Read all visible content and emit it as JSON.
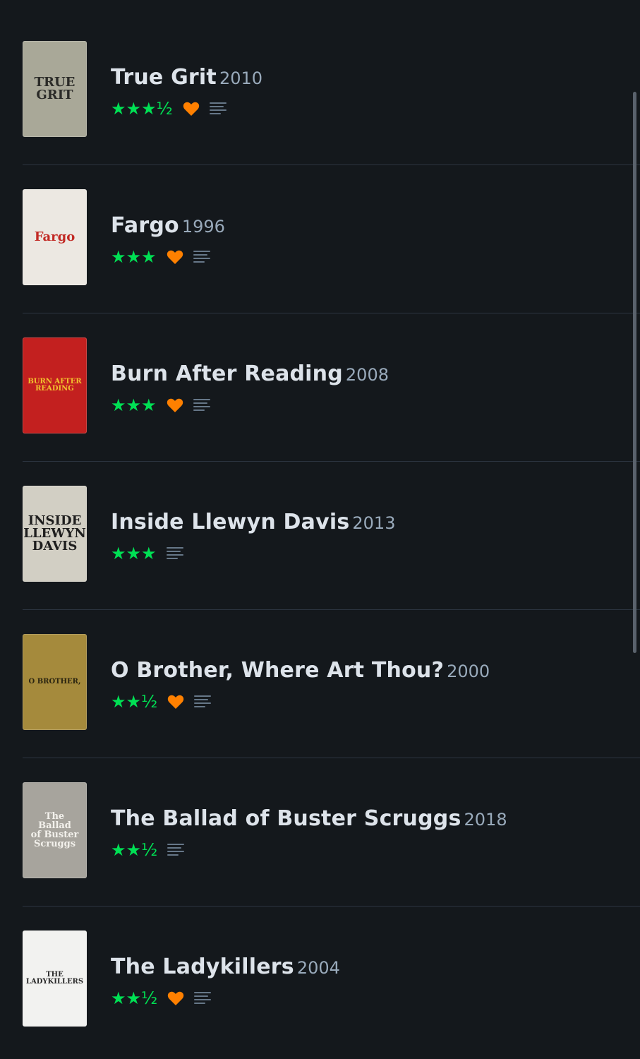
{
  "films": [
    {
      "title": "True Grit",
      "year": "2010",
      "stars": "★★★½",
      "rating": 3.5,
      "liked": true,
      "has_review": true,
      "poster": {
        "text": "TRUE\nGRIT",
        "bg": "#a9a898",
        "fg": "#2b2b28"
      }
    },
    {
      "title": "Fargo",
      "year": "1996",
      "stars": "★★★",
      "rating": 3,
      "liked": true,
      "has_review": true,
      "poster": {
        "text": "Fargo",
        "bg": "#ece8e2",
        "fg": "#c22a25"
      }
    },
    {
      "title": "Burn After Reading",
      "year": "2008",
      "stars": "★★★",
      "rating": 3,
      "liked": true,
      "has_review": true,
      "poster": {
        "text": "BURN AFTER\nREADING",
        "bg": "#c3201f",
        "fg": "#f2c12e"
      }
    },
    {
      "title": "Inside Llewyn Davis",
      "year": "2013",
      "stars": "★★★",
      "rating": 3,
      "liked": false,
      "has_review": true,
      "poster": {
        "text": "INSIDE\nLLEWYN\nDAVIS",
        "bg": "#d2cfc4",
        "fg": "#1e1e1e"
      }
    },
    {
      "title": "O Brother, Where Art Thou?",
      "year": "2000",
      "stars": "★★½",
      "rating": 2.5,
      "liked": true,
      "has_review": true,
      "poster": {
        "text": "O BROTHER,",
        "bg": "#a58a3c",
        "fg": "#2a2410"
      }
    },
    {
      "title": "The Ballad of Buster Scruggs",
      "year": "2018",
      "stars": "★★½",
      "rating": 2.5,
      "liked": false,
      "has_review": true,
      "poster": {
        "text": "The\nBallad\nof Buster\nScruggs",
        "bg": "#a7a49d",
        "fg": "#f3f1ec"
      }
    },
    {
      "title": "The Ladykillers",
      "year": "2004",
      "stars": "★★½",
      "rating": 2.5,
      "liked": true,
      "has_review": true,
      "poster": {
        "text": "THE LADYKILLERS",
        "bg": "#f2f2f0",
        "fg": "#2a2a2a"
      }
    }
  ],
  "colors": {
    "background": "#14181c",
    "star": "#00e054",
    "heart": "#ff8000",
    "review_icon": "#678",
    "title": "#dde3ea",
    "year": "#99aabb"
  }
}
